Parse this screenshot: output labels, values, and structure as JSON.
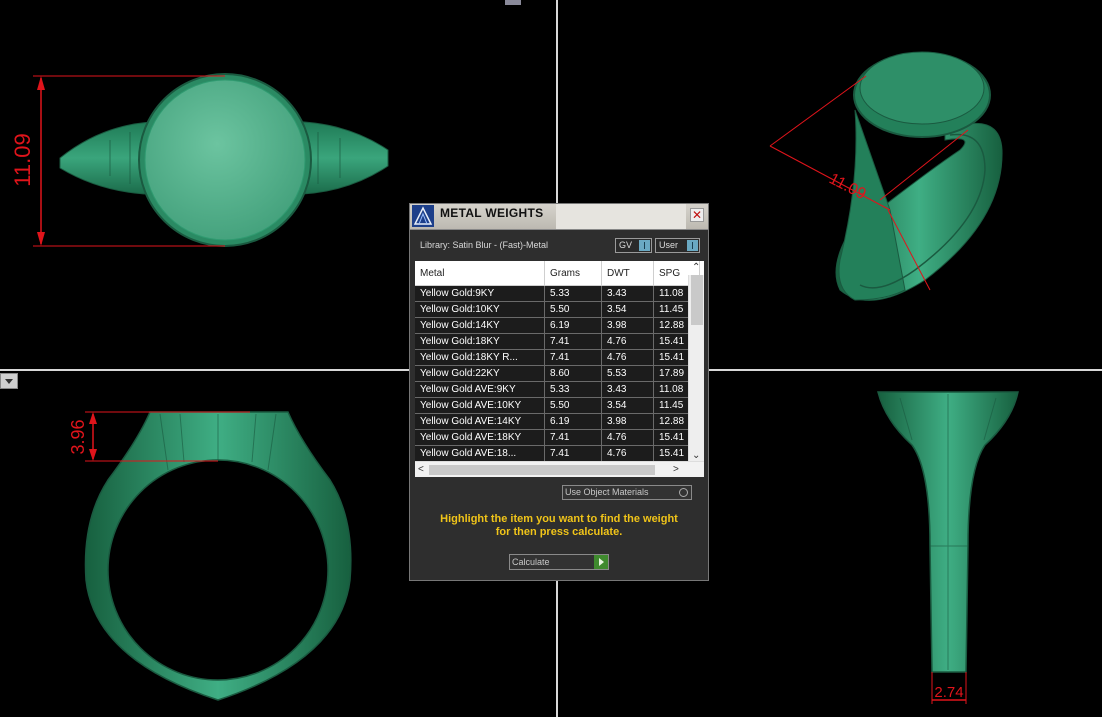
{
  "viewport": {
    "dimensions": {
      "top": "11.09",
      "iso": "11.09",
      "front": "3.96",
      "side": "2.74"
    }
  },
  "dialog": {
    "title": "METAL WEIGHTS",
    "library_label": "Library: Satin Blur - (Fast)-Metal",
    "toggle_gv": "GV",
    "toggle_user": "User",
    "columns": [
      "Metal",
      "Grams",
      "DWT",
      "SPG"
    ],
    "rows": [
      {
        "metal": "Yellow Gold:9KY",
        "grams": "5.33",
        "dwt": "3.43",
        "spg": "11.08"
      },
      {
        "metal": "Yellow Gold:10KY",
        "grams": "5.50",
        "dwt": "3.54",
        "spg": "11.45"
      },
      {
        "metal": "Yellow Gold:14KY",
        "grams": "6.19",
        "dwt": "3.98",
        "spg": "12.88"
      },
      {
        "metal": "Yellow Gold:18KY",
        "grams": "7.41",
        "dwt": "4.76",
        "spg": "15.41"
      },
      {
        "metal": "Yellow Gold:18KY R...",
        "grams": "7.41",
        "dwt": "4.76",
        "spg": "15.41"
      },
      {
        "metal": "Yellow Gold:22KY",
        "grams": "8.60",
        "dwt": "5.53",
        "spg": "17.89"
      },
      {
        "metal": "Yellow Gold AVE:9KY",
        "grams": "5.33",
        "dwt": "3.43",
        "spg": "11.08"
      },
      {
        "metal": "Yellow Gold AVE:10KY",
        "grams": "5.50",
        "dwt": "3.54",
        "spg": "11.45"
      },
      {
        "metal": "Yellow Gold AVE:14KY",
        "grams": "6.19",
        "dwt": "3.98",
        "spg": "12.88"
      },
      {
        "metal": "Yellow Gold AVE:18KY",
        "grams": "7.41",
        "dwt": "4.76",
        "spg": "15.41"
      },
      {
        "metal": "Yellow Gold AVE:18...",
        "grams": "7.41",
        "dwt": "4.76",
        "spg": "15.41"
      }
    ],
    "use_object_materials": "Use Object Materials",
    "hint_line1": "Highlight the item you want to find the weight",
    "hint_line2": "for then press calculate.",
    "calculate_label": "Calculate"
  },
  "colors": {
    "ring": "#2f9a70",
    "dimension": "#e0141b",
    "hint": "#f0c419"
  }
}
